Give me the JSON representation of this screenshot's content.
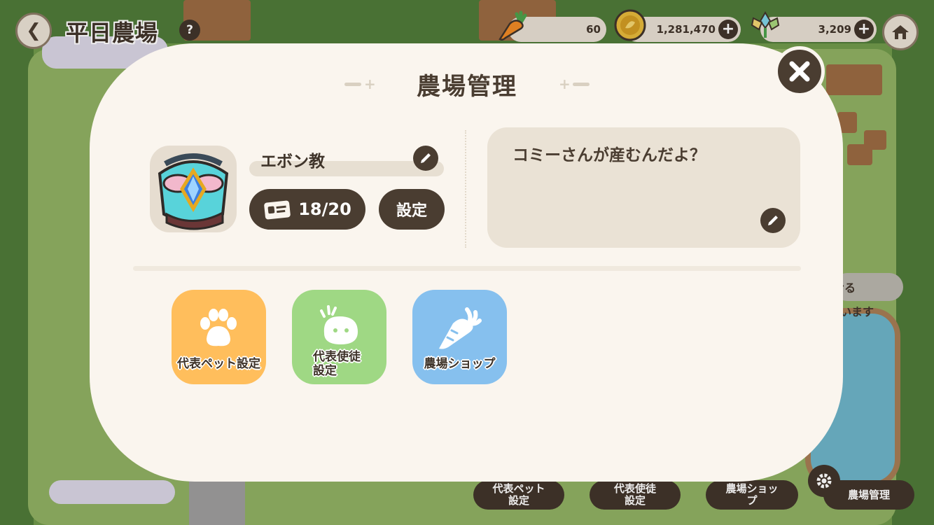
{
  "header": {
    "farm_name": "平日農場",
    "info_icon_glyph": "?"
  },
  "currencies": [
    {
      "name": "carrot",
      "icon": "carrot-icon",
      "value": "60"
    },
    {
      "name": "coin",
      "icon": "gold-coin-icon",
      "value": "1,281,470"
    },
    {
      "name": "gem",
      "icon": "crystal-flower-icon",
      "value": "3,209"
    }
  ],
  "modal": {
    "title": "農場管理",
    "farm_display_name": "エボン教",
    "member_count": "18/20",
    "settings_label": "設定",
    "message": "コミーさんが産むんだよ？"
  },
  "actions": [
    {
      "label": "代表ペット設定",
      "icon": "paw-icon",
      "color": "#ffbe5c"
    },
    {
      "label": "代表使徒設定",
      "label_line1": "代表使徒",
      "label_line2": "設定",
      "icon": "blob-creature-icon",
      "color": "#9fd884"
    },
    {
      "label": "農場ショップ",
      "icon": "carrot-icon",
      "color": "#86c0ee"
    }
  ],
  "bottom_nav": {
    "pet": "代表ペット設定",
    "pet_line1": "代表ペット",
    "pet_line2": "設定",
    "apostle_line1": "代表使徒",
    "apostle_line2": "設定",
    "shop_line1": "農場ショッ",
    "shop_line2": "プ",
    "manage": "農場管理"
  },
  "background_text": {
    "fragment1": "せる",
    "fragment2": "います"
  },
  "colors": {
    "modal_bg": "#faf5ee",
    "dark_brown": "#4a3d31",
    "beige": "#eae2d5"
  }
}
